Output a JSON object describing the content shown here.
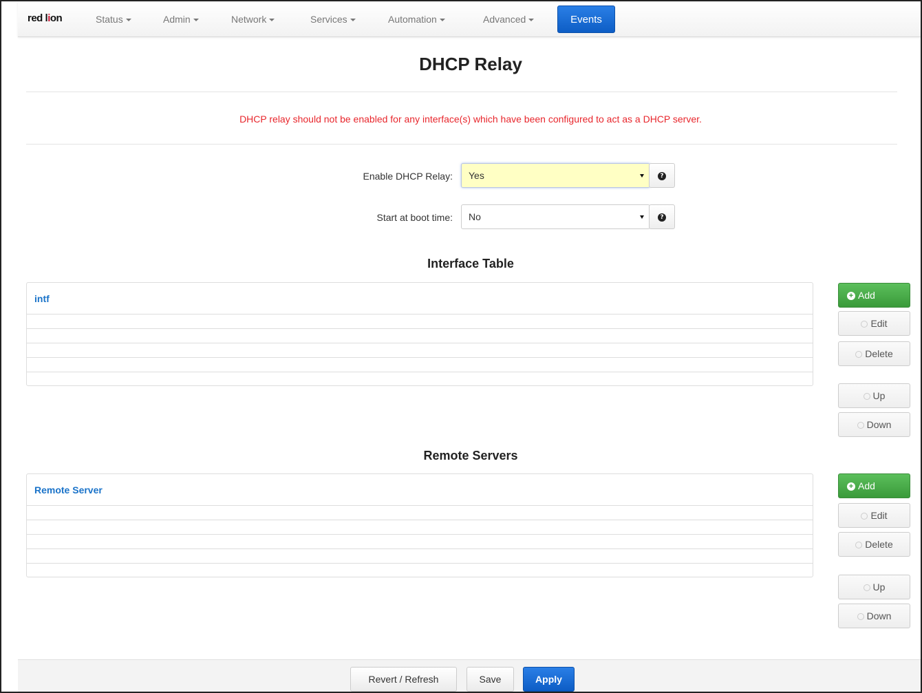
{
  "brand": {
    "logo_text_1": "red l",
    "logo_text_2": "i",
    "logo_text_3": "on"
  },
  "nav": {
    "items": [
      {
        "label": "Status"
      },
      {
        "label": "Admin"
      },
      {
        "label": "Network"
      },
      {
        "label": "Services"
      },
      {
        "label": "Automation"
      },
      {
        "label": "Advanced"
      }
    ],
    "events_label": "Events"
  },
  "page": {
    "title": "DHCP Relay",
    "warning": "DHCP relay should not be enabled for any interface(s) which have been configured to act as a DHCP server."
  },
  "form": {
    "enable": {
      "label": "Enable DHCP Relay:",
      "value": "Yes"
    },
    "boot": {
      "label": "Start at boot time:",
      "value": "No"
    }
  },
  "interface_table": {
    "title": "Interface Table",
    "column": "intf",
    "buttons": {
      "add": "Add",
      "edit": "Edit",
      "delete": "Delete",
      "up": "Up",
      "down": "Down"
    }
  },
  "remote_servers": {
    "title": "Remote Servers",
    "column": "Remote Server",
    "buttons": {
      "add": "Add",
      "edit": "Edit",
      "delete": "Delete",
      "up": "Up",
      "down": "Down"
    }
  },
  "footer": {
    "revert": "Revert / Refresh",
    "save": "Save",
    "apply": "Apply"
  },
  "colors": {
    "warning": "#e8262c",
    "accent": "#0d5dc5",
    "add": "#3a9a3a",
    "link": "#1a73c9",
    "highlight": "#ffffc4"
  },
  "icons": {
    "help": "question-circle-icon",
    "add": "plus-circle-icon",
    "edit": "pencil-icon",
    "delete": "minus-circle-icon",
    "up": "arrow-up-icon",
    "down": "arrow-down-icon"
  }
}
